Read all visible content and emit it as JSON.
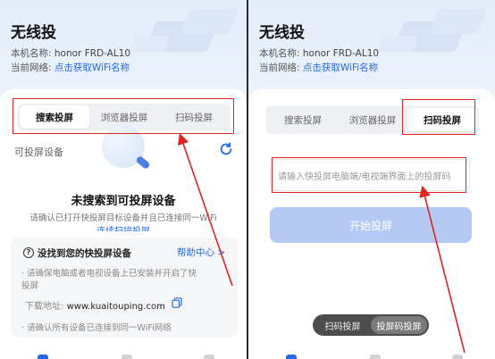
{
  "left": {
    "title": "无线投",
    "device_label": "本机名称: ",
    "device_name": "honor FRD-AL10",
    "network_label": "当前网络: ",
    "network_link": "点击获取WiFi名称",
    "tabs": [
      {
        "label": "搜索投屏",
        "active": true
      },
      {
        "label": "浏览器投屏",
        "active": false
      },
      {
        "label": "扫码投屏",
        "active": false
      }
    ],
    "available_label": "可投屏设备",
    "no_device_title": "未搜索到可投屏设备",
    "no_device_sub": "请确认已打开快投屏目标设备并且已连接同一WiFi",
    "no_device_cut": "连续扫描投屏",
    "help": {
      "title": "没找到您的快投屏设备",
      "link": "帮助中心 >",
      "line1": "· 请确保电脑或者电视设备上已安装并开启了快",
      "line2": "投屏",
      "download_label": "下载地址: ",
      "download_url": "www.kuaitouping.com",
      "line4": "· 请确认所有设备已连接到同一WiFi网络"
    }
  },
  "right": {
    "title": "无线投",
    "device_label": "本机名称: ",
    "device_name": "honor FRD-AL10",
    "network_label": "当前网络: ",
    "network_link": "点击获取WiFi名称",
    "tabs": [
      {
        "label": "搜索投屏",
        "active": false
      },
      {
        "label": "浏览器投屏",
        "active": false
      },
      {
        "label": "扫码投屏",
        "active": true
      }
    ],
    "code_placeholder": "请输入快投屏电脑端/电视端界面上的投屏码",
    "start_button": "开始投屏",
    "mode_toggle": [
      {
        "label": "扫码投屏",
        "active": false
      },
      {
        "label": "投屏码投屏",
        "active": true
      }
    ]
  },
  "colors": {
    "accent": "#2468e8",
    "highlight": "#e02424",
    "button_disabled": "#b4caf4"
  }
}
